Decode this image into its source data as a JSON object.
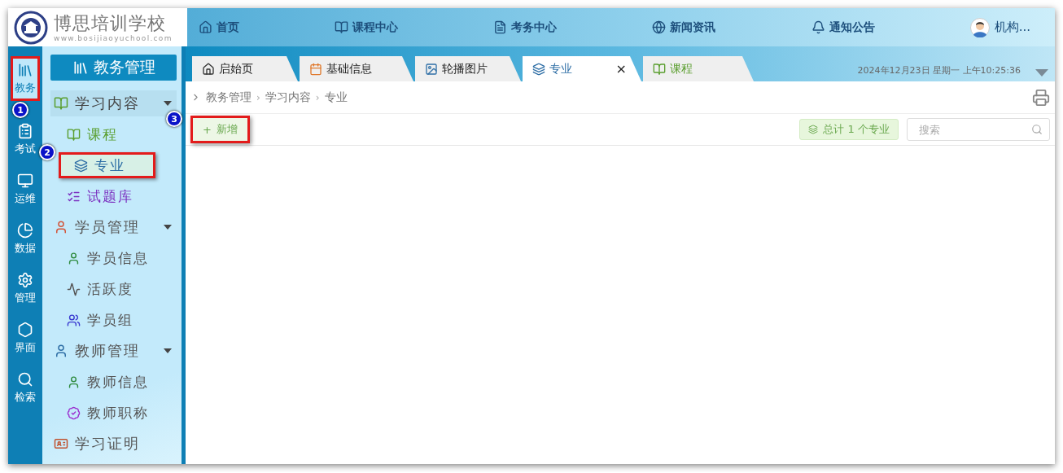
{
  "logo": {
    "name": "博思培训学校",
    "url": "www.bosijiaoyuchool.com"
  },
  "top_nav": [
    {
      "label": "首页"
    },
    {
      "label": "课程中心"
    },
    {
      "label": "考务中心"
    },
    {
      "label": "新闻资讯"
    },
    {
      "label": "通知公告"
    }
  ],
  "user": {
    "name": "机构..."
  },
  "rail": [
    {
      "label": "教务",
      "selected": true,
      "highlighted": true,
      "callout": "1"
    },
    {
      "label": "考试",
      "selected": false,
      "highlighted": false
    },
    {
      "label": "运维",
      "selected": false,
      "highlighted": false
    },
    {
      "label": "数据",
      "selected": false,
      "highlighted": false
    },
    {
      "label": "管理",
      "selected": false,
      "highlighted": false
    },
    {
      "label": "界面",
      "selected": false,
      "highlighted": false
    },
    {
      "label": "检索",
      "selected": false,
      "highlighted": false
    }
  ],
  "sidebar": {
    "title": "教务管理",
    "items": [
      {
        "label": "学习内容",
        "expanded": true,
        "selected": true,
        "children": [
          {
            "label": "课程",
            "selected": false,
            "highlighted": false
          },
          {
            "label": "专业",
            "selected": true,
            "highlighted": true,
            "callout": "2"
          },
          {
            "label": "试题库",
            "selected": false,
            "highlighted": false
          }
        ]
      },
      {
        "label": "学员管理",
        "expanded": true,
        "selected": false,
        "children": [
          {
            "label": "学员信息",
            "selected": false,
            "highlighted": false
          },
          {
            "label": "活跃度",
            "selected": false,
            "highlighted": false
          },
          {
            "label": "学员组",
            "selected": false,
            "highlighted": false
          }
        ]
      },
      {
        "label": "教师管理",
        "expanded": true,
        "selected": false,
        "children": [
          {
            "label": "教师信息",
            "selected": false,
            "highlighted": false
          },
          {
            "label": "教师职称",
            "selected": false,
            "highlighted": false
          }
        ]
      },
      {
        "label": "学习证明",
        "selected": false
      }
    ]
  },
  "tabs": [
    {
      "label": "启始页",
      "selected": false
    },
    {
      "label": "基础信息",
      "selected": false
    },
    {
      "label": "轮播图片",
      "selected": false
    },
    {
      "label": "专业",
      "selected": true,
      "close": "×"
    },
    {
      "label": "课程",
      "selected": false
    }
  ],
  "datetime": "2024年12月23日 星期一 上午10:25:36",
  "breadcrumb": {
    "separator": "›",
    "items": [
      "教务管理",
      "学习内容",
      "专业"
    ]
  },
  "toolbar": {
    "add_button": {
      "label": "新增",
      "icon": "+",
      "highlighted": true,
      "callout": "3"
    },
    "total": "总计 1 个专业",
    "search": {
      "placeholder": "搜索"
    }
  }
}
